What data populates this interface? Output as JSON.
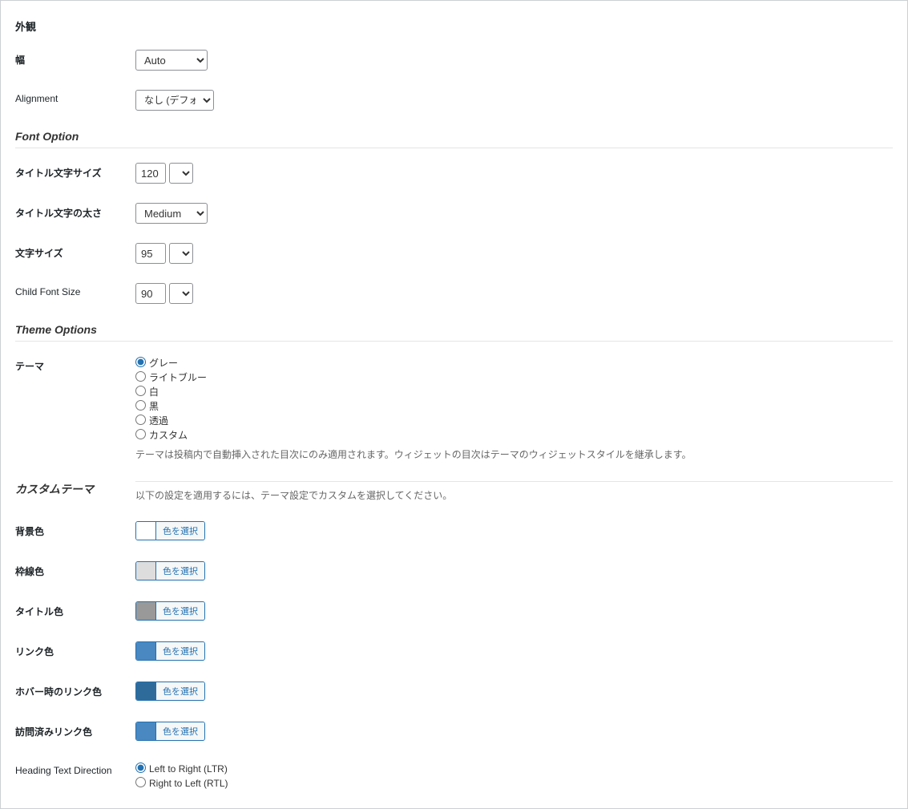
{
  "appearance": {
    "heading": "外観",
    "width": {
      "label": "幅",
      "value": "Auto"
    },
    "alignment": {
      "label": "Alignment",
      "value": "なし (デフォルト)"
    }
  },
  "font": {
    "heading": "Font Option",
    "title_size": {
      "label": "タイトル文字サイズ",
      "value": "120",
      "unit": "%"
    },
    "title_weight": {
      "label": "タイトル文字の太さ",
      "value": "Medium"
    },
    "font_size": {
      "label": "文字サイズ",
      "value": "95",
      "unit": "%"
    },
    "child_size": {
      "label": "Child Font Size",
      "value": "90",
      "unit": "%"
    }
  },
  "theme": {
    "heading": "Theme Options",
    "label": "テーマ",
    "options": {
      "gray": "グレー",
      "lightblue": "ライトブルー",
      "white": "白",
      "black": "黒",
      "transparent": "透過",
      "custom": "カスタム"
    },
    "selected": "gray",
    "desc": "テーマは投稿内で自動挿入された目次にのみ適用されます。ウィジェットの目次はテーマのウィジェットスタイルを継承します。"
  },
  "custom_theme": {
    "heading": "カスタムテーマ",
    "desc": "以下の設定を適用するには、テーマ設定でカスタムを選択してください。",
    "pick_label": "色を選択",
    "bg": {
      "label": "背景色",
      "color": "#ffffff"
    },
    "border": {
      "label": "枠線色",
      "color": "#dddddd"
    },
    "title": {
      "label": "タイトル色",
      "color": "#999999"
    },
    "link": {
      "label": "リンク色",
      "color": "#4a88c2"
    },
    "hover": {
      "label": "ホバー時のリンク色",
      "color": "#2f6b9a"
    },
    "visited": {
      "label": "訪問済みリンク色",
      "color": "#4a88c2"
    }
  },
  "direction": {
    "label": "Heading Text Direction",
    "ltr": "Left to Right (LTR)",
    "rtl": "Right to Left (RTL)",
    "selected": "ltr"
  }
}
